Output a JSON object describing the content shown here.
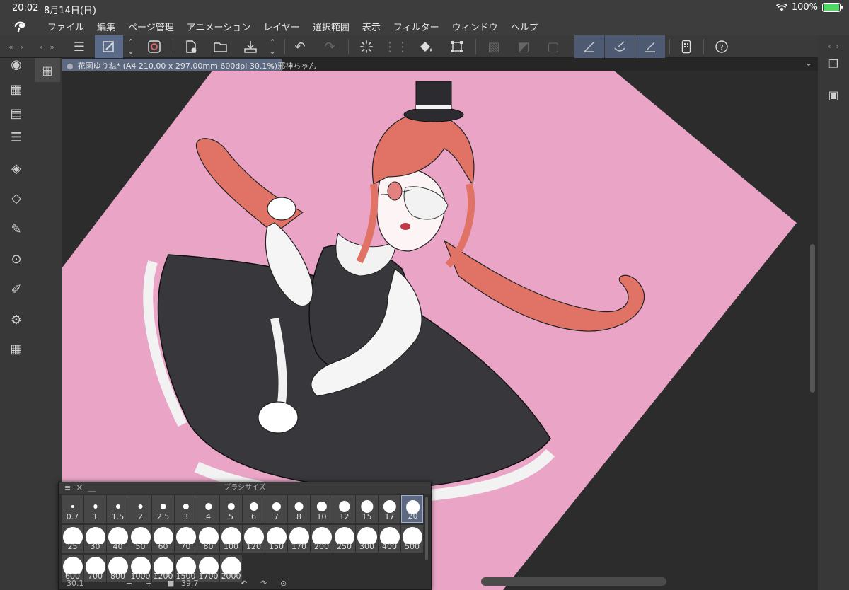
{
  "status_bar": {
    "time": "20:02",
    "date": "8月14日(日)",
    "battery": "100%"
  },
  "menu": [
    "ファイル",
    "編集",
    "ページ管理",
    "アニメーション",
    "レイヤー",
    "選択範囲",
    "表示",
    "フィルター",
    "ウィンドウ",
    "ヘルプ"
  ],
  "tabs": {
    "active": "花園ゆりね* (A4 210.00 x 297.00mm 600dpi 30.1%)",
    "inactive": "邪神ちゃん"
  },
  "brush_panel": {
    "title": "ブラシサイズ",
    "sizes": [
      "0.7",
      "1",
      "1.5",
      "2",
      "2.5",
      "3",
      "4",
      "5",
      "6",
      "7",
      "8",
      "10",
      "12",
      "15",
      "17",
      "20",
      "25",
      "30",
      "40",
      "50",
      "60",
      "70",
      "80",
      "100",
      "120",
      "150",
      "170",
      "200",
      "250",
      "300",
      "400",
      "500",
      "600",
      "700",
      "800",
      "1000",
      "1200",
      "1500",
      "1700",
      "2000"
    ],
    "selected": "20"
  },
  "bottom_nav": {
    "zoom": "30.1",
    "angle": "39.7"
  },
  "colors": {
    "canvas_pink": "#e9a4c6",
    "hair": "#e07366",
    "dress": "#38383c",
    "accent": "#5d6980"
  }
}
